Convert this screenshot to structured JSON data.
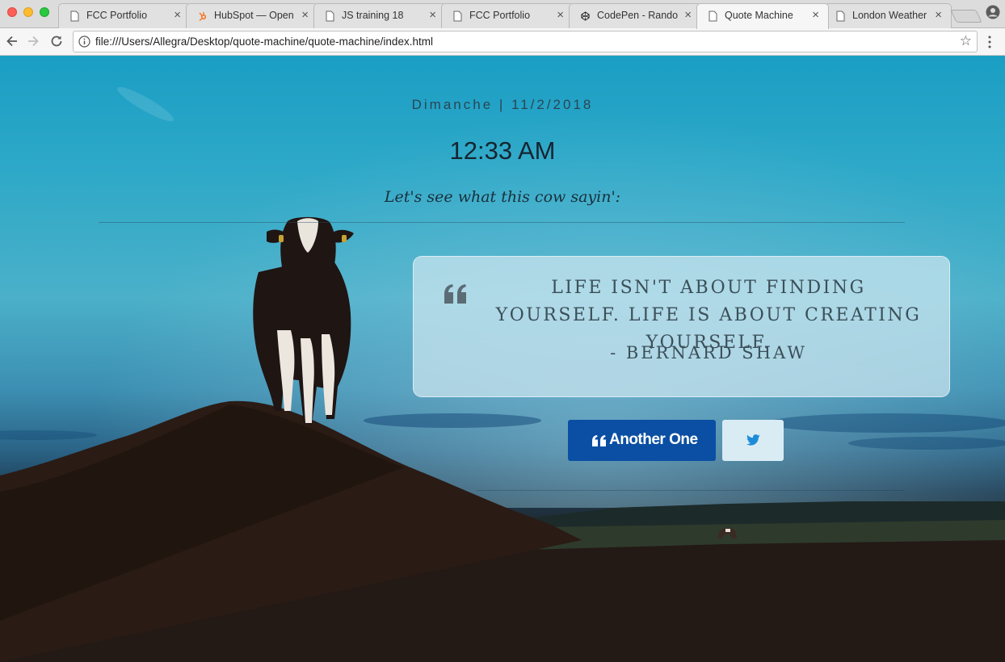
{
  "browser": {
    "tabs": [
      {
        "title": "FCC Portfolio",
        "icon": "page-icon",
        "active": false
      },
      {
        "title": "HubSpot — Open",
        "icon": "hubspot-icon",
        "active": false
      },
      {
        "title": "JS training 18",
        "icon": "page-icon",
        "active": false
      },
      {
        "title": "FCC Portfolio",
        "icon": "page-icon",
        "active": false
      },
      {
        "title": "CodePen - Rando",
        "icon": "codepen-icon",
        "active": false
      },
      {
        "title": "Quote Machine",
        "icon": "page-icon",
        "active": true
      },
      {
        "title": "London Weather",
        "icon": "page-icon",
        "active": false
      }
    ],
    "close_glyph": "×",
    "url": "file:///Users/Allegra/Desktop/quote-machine/quote-machine/index.html",
    "star_glyph": "☆"
  },
  "page": {
    "date_line": "Dimanche | 11/2/2018",
    "time": "12:33 AM",
    "cow_says": "Let's see what this cow sayin':",
    "quote": {
      "text": "Life isn't about finding yourself. Life is about creating yourself.",
      "author": "- Bernard Shaw"
    },
    "buttons": {
      "another_label": "Another One",
      "another_icon": "quote-left-icon",
      "tweet_icon": "twitter-icon"
    },
    "colors": {
      "primary_button": "#0a4fa3",
      "tweet_button": "#d9ecf3",
      "twitter_blue": "#1d8cd8"
    }
  }
}
